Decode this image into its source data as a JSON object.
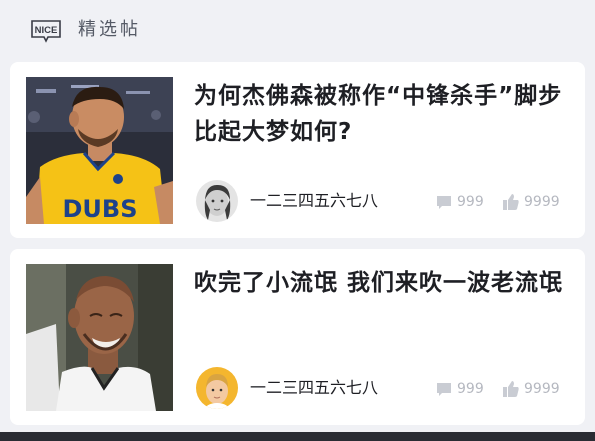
{
  "header": {
    "logo_text": "NICE",
    "section_title": "精选帖"
  },
  "posts": [
    {
      "title": "为何杰佛森被称作“中锋杀手”脚步比起大梦如何?",
      "jersey_text": "DUBS",
      "author": "一二三四五六七八",
      "comments": "999",
      "likes": "9999"
    },
    {
      "title": "吹完了小流氓 我们来吹一波老流氓",
      "author": "一二三四五六七八",
      "comments": "999",
      "likes": "9999"
    }
  ],
  "icons": {
    "comment": "comment-icon",
    "like": "thumbs-up-icon"
  },
  "colors": {
    "background": "#f0f1f5",
    "card": "#ffffff",
    "title_text": "#1e1f24",
    "meta_text": "#b5b8c0",
    "jersey": "#f5c216",
    "jersey_text": "#1d428a"
  }
}
